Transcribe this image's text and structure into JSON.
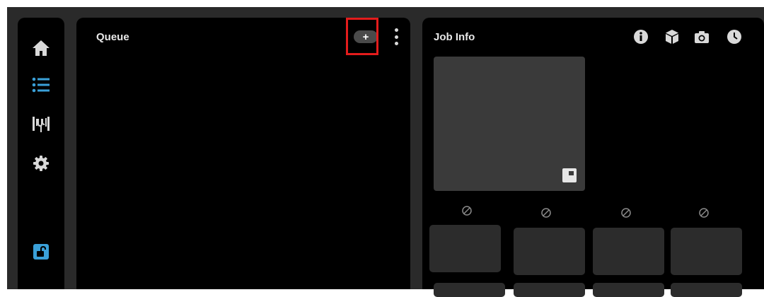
{
  "sidebar": {
    "items": [
      {
        "name": "home",
        "icon": "home-icon"
      },
      {
        "name": "queue",
        "icon": "list-icon",
        "active": true
      },
      {
        "name": "filament",
        "icon": "filament-icon"
      },
      {
        "name": "settings",
        "icon": "gear-icon"
      }
    ],
    "lock": {
      "icon": "unlock-icon"
    }
  },
  "queue": {
    "title": "Queue",
    "add_label": "+",
    "menu_icon": "more-vertical-icon"
  },
  "job_info": {
    "title": "Job Info",
    "icons": [
      "info-icon",
      "cube-icon",
      "camera-icon",
      "clock-icon"
    ]
  },
  "colors": {
    "background": "#000000",
    "frame": "#2a2a2a",
    "accent": "#3aa0d8",
    "highlight": "#e31c1c",
    "icon": "#d9d9d9"
  }
}
